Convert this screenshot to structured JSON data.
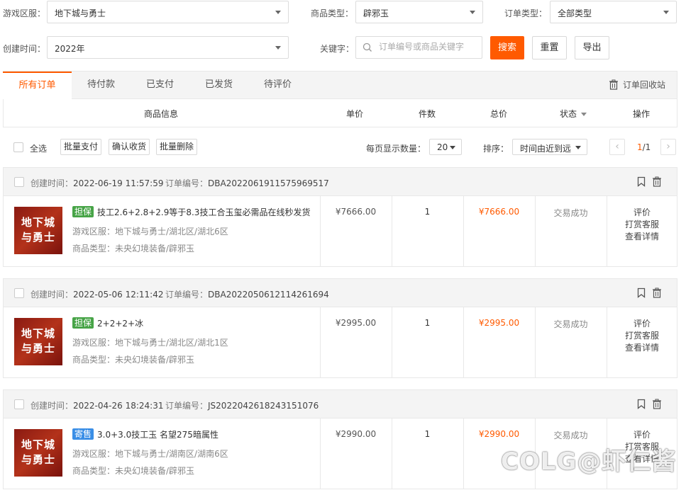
{
  "filters": {
    "region": {
      "label": "游戏区服：",
      "value": "地下城与勇士"
    },
    "product_type": {
      "label": "商品类型：",
      "value": "辟邪玉"
    },
    "order_type": {
      "label": "订单类型：",
      "value": "全部类型"
    },
    "created_time": {
      "label": "创建时间：",
      "value": "2022年"
    },
    "keyword": {
      "label": "关键字：",
      "placeholder": "订单编号或商品关键字"
    },
    "search_label": "搜索",
    "reset_label": "重置",
    "export_label": "导出"
  },
  "tabs": [
    {
      "label": "所有订单",
      "active": true
    },
    {
      "label": "待付款"
    },
    {
      "label": "已支付"
    },
    {
      "label": "已发货"
    },
    {
      "label": "待评价"
    }
  ],
  "recycle_label": "订单回收站",
  "columns": {
    "product": "商品信息",
    "unit_price": "单价",
    "quantity": "件数",
    "total": "总价",
    "status": "状态",
    "action": "操作"
  },
  "toolbar": {
    "select_all": "全选",
    "bulk_pay": "批量支付",
    "confirm_receipt": "确认收货",
    "bulk_delete": "批量删除",
    "page_size_label": "每页显示数量：",
    "page_size": "20",
    "sort_label": "排序：",
    "sort_value": "时间由近到远",
    "page_current": "1",
    "page_total": "/1",
    "prev": "‹",
    "next": "›"
  },
  "orders": [
    {
      "created_label": "创建时间：",
      "created": "2022-06-19 11:57:59",
      "order_no_label": "订单编号：",
      "order_no": "DBA2022061911575969517",
      "thumb_text_1": "地下城",
      "thumb_text_2": "与勇士",
      "tag": "担保",
      "tag_color": "#47a447",
      "title": "技工2.6+2.8+2.9等于8.3技工合玉玺必需品在线秒发货",
      "region": "游戏区服：地下城与勇士/湖北区/湖北6区",
      "type": "商品类型：未央幻境装备/辟邪玉",
      "unit_price": "¥7666.00",
      "quantity": "1",
      "total": "¥7666.00",
      "status": "交易成功",
      "ops": [
        "评价",
        "打赏客服",
        "查看详情"
      ]
    },
    {
      "created_label": "创建时间：",
      "created": "2022-05-06 12:11:42",
      "order_no_label": "订单编号：",
      "order_no": "DBA2022050612114261694",
      "thumb_text_1": "地下城",
      "thumb_text_2": "与勇士",
      "tag": "担保",
      "tag_color": "#47a447",
      "title": "2+2+2+冰",
      "region": "游戏区服：地下城与勇士/湖北区/湖北1区",
      "type": "商品类型：未央幻境装备/辟邪玉",
      "unit_price": "¥2995.00",
      "quantity": "1",
      "total": "¥2995.00",
      "status": "交易成功",
      "ops": [
        "评价",
        "打赏客服",
        "查看详情"
      ]
    },
    {
      "created_label": "创建时间：",
      "created": "2022-04-26 18:24:31",
      "order_no_label": "订单编号：",
      "order_no": "JS2022042618243151076",
      "thumb_text_1": "地下城",
      "thumb_text_2": "与勇士",
      "tag": "寄售",
      "tag_color": "#3a8ee6",
      "title": "3.0+3.0技工玉 名望275暗属性",
      "region": "游戏区服：地下城与勇士/湖南区/湖南6区",
      "type": "商品类型：未央幻境装备/辟邪玉",
      "unit_price": "¥2990.00",
      "quantity": "1",
      "total": "¥2990.00",
      "status": "交易成功",
      "ops": [
        "评价",
        "打赏客服",
        "查看详情"
      ]
    }
  ],
  "watermark": "COLG@虾仁酱",
  "colors": {
    "accent": "#ff5a00",
    "tag_green": "#47a447",
    "tag_blue": "#3a8ee6"
  }
}
